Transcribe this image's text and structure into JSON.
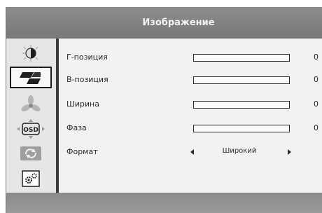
{
  "menu": {
    "title": "Изображение"
  },
  "sidebar": {
    "items": [
      {
        "icon": "brightness-contrast-icon",
        "active": false
      },
      {
        "icon": "image-geometry-icon",
        "active": true
      },
      {
        "icon": "color-icon",
        "active": false
      },
      {
        "icon": "osd-settings-icon",
        "active": false
      },
      {
        "icon": "reset-icon",
        "active": false
      },
      {
        "icon": "setup-icon",
        "active": false
      }
    ]
  },
  "settings": [
    {
      "label": "Г-позиция",
      "value": "0",
      "level": 0
    },
    {
      "label": "В-позиция",
      "value": "0",
      "level": 0
    },
    {
      "label": "Ширина",
      "value": "0",
      "level": 0
    },
    {
      "label": "Фаза",
      "value": "0",
      "level": 0
    }
  ],
  "format": {
    "label": "Формат",
    "option": "Широкий"
  },
  "colors": {
    "title_bar": "#808080",
    "panel": "#f2f2f2",
    "divider": "#3b3b3b",
    "highlight_border": "#1d1d1d"
  }
}
